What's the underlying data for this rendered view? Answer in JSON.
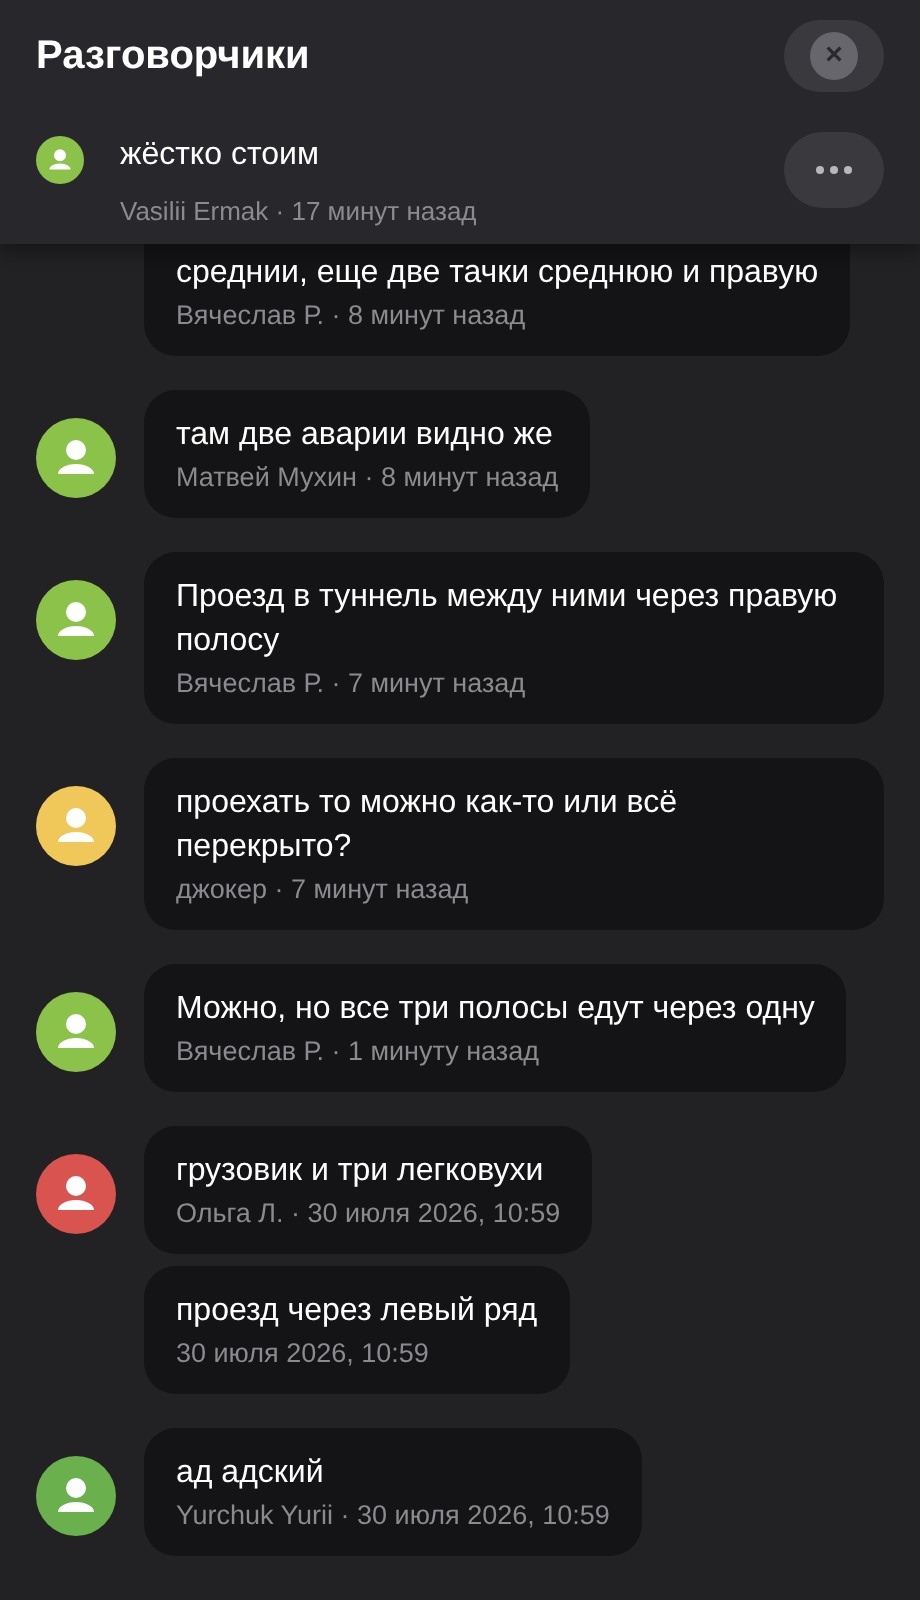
{
  "header": {
    "title": "Разговорчики",
    "close_icon": "×"
  },
  "pinned": {
    "text": "жёстко стоим",
    "meta": "Vasilii Ermak · 17 минут назад",
    "color": "#8bc34a"
  },
  "messages": [
    {
      "text": "среднии, еще две тачки среднюю и правую",
      "meta": "Вячеслав Р. · 8 минут назад"
    },
    {
      "text": "там две аварии видно же",
      "meta": "Матвей Мухин · 8 минут назад",
      "color": "#8bc34a"
    },
    {
      "text": "Проезд в туннель между ними через правую полосу",
      "meta": "Вячеслав Р. · 7 минут назад",
      "color": "#8bc34a"
    },
    {
      "text": "проехать то можно как-то или всё перекрыто?",
      "meta": "джокер · 7 минут назад",
      "color": "#f0c85a"
    },
    {
      "text": "Можно, но все три полосы едут через одну",
      "meta": "Вячеслав Р. · 1 минуту назад",
      "color": "#8bc34a"
    },
    {
      "text": "грузовик и три легковухи",
      "meta": "Ольга Л. · 30 июля 2026, 10:59",
      "color": "#d9534f"
    },
    {
      "text": "проезд через левый ряд",
      "meta": "30 июля 2026, 10:59"
    },
    {
      "text": "ад адский",
      "meta": "Yurchuk Yurii · 30 июля 2026, 10:59",
      "color": "#6ab04c"
    }
  ]
}
